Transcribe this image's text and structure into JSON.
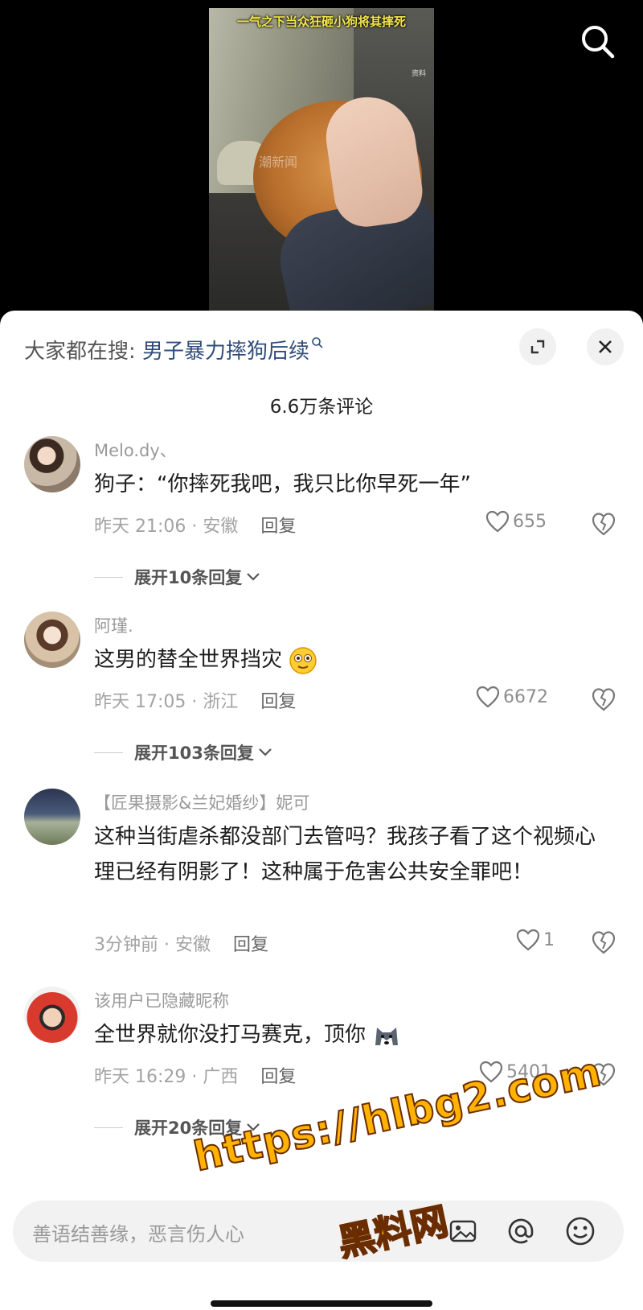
{
  "video": {
    "caption": "一气之下当众狂砸小狗将其摔死",
    "watermark": "潮新闻",
    "tag": "资料"
  },
  "search_suggest": {
    "prefix": "大家都在搜: ",
    "keyword": "男子暴力摔狗后续"
  },
  "comment_count": "6.6万条评论",
  "comments": [
    {
      "name": "Melo.dy、",
      "text": "狗子：“你摔死我吧，我只比你早死一年”",
      "time": "昨天 21:06 · 安徽",
      "reply": "回复",
      "likes": "655",
      "expand": "展开10条回复"
    },
    {
      "name": "阿瑾.",
      "text": "这男的替全世界挡灾",
      "time": "昨天 17:05 · 浙江",
      "reply": "回复",
      "likes": "6672",
      "expand": "展开103条回复"
    },
    {
      "name": "【匠果摄影&兰妃婚纱】妮可",
      "text": "这种当街虐杀都没部门去管吗？我孩子看了这个视频心理已经有阴影了！这种属于危害公共安全罪吧！",
      "time": "3分钟前 · 安徽",
      "reply": "回复",
      "likes": "1"
    },
    {
      "name": "该用户已隐藏昵称",
      "text": "全世界就你没打马赛克，顶你",
      "time": "昨天 16:29 · 广西",
      "reply": "回复",
      "likes": "5401",
      "expand": "展开20条回复"
    }
  ],
  "input": {
    "placeholder": "善语结善缘，恶言伤人心"
  },
  "overlay": {
    "url": "https://hlbg2.com",
    "site": "黑料网"
  },
  "colors": {
    "keyword": "#2f4d7a",
    "overlay_fill": "#ffb300",
    "overlay_stroke": "#6b2d00",
    "video_caption": "#f5e84a"
  },
  "icons": [
    "search-icon",
    "expand-icon",
    "close-icon",
    "heart-icon",
    "broken-heart-icon",
    "image-icon",
    "at-icon",
    "smile-icon",
    "chevron-down-icon"
  ]
}
